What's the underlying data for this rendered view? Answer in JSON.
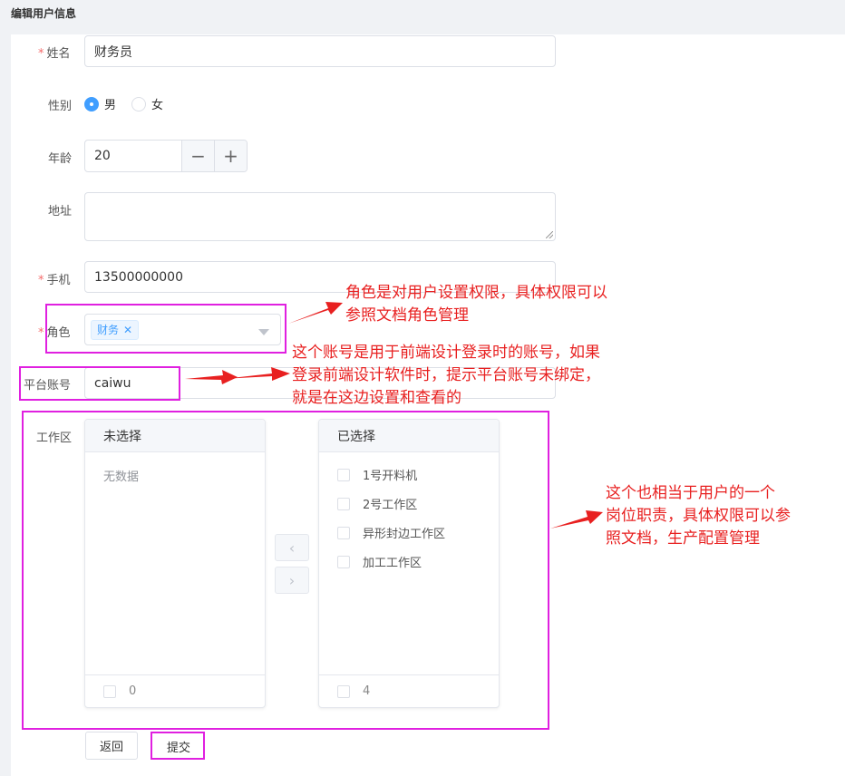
{
  "page": {
    "title": "编辑用户信息"
  },
  "form": {
    "name": {
      "label": "姓名",
      "required_mark": "*",
      "value": "财务员"
    },
    "gender": {
      "label": "性别",
      "options": [
        "男",
        "女"
      ],
      "selected": "男"
    },
    "age": {
      "label": "年龄",
      "value": "20",
      "minus": "−",
      "plus": "+"
    },
    "address": {
      "label": "地址",
      "value": ""
    },
    "phone": {
      "label": "手机",
      "required_mark": "*",
      "value": "13500000000"
    },
    "role": {
      "label": "角色",
      "required_mark": "*",
      "tag": "财务",
      "tag_close": "✕"
    },
    "platform_account": {
      "label": "平台账号",
      "value": "caiwu"
    },
    "workzone": {
      "label": "工作区",
      "left_title": "未选择",
      "left_empty": "无数据",
      "left_count": "0",
      "right_title": "已选择",
      "right_items": [
        "1号开料机",
        "2号工作区",
        "异形封边工作区",
        "加工工作区"
      ],
      "right_count": "4",
      "to_left": "‹",
      "to_right": "›"
    },
    "back_label": "返回",
    "submit_label": "提交"
  },
  "annotations": {
    "role_note": [
      "角色是对用户设置权限，具体权限可以",
      "参照文档角色管理"
    ],
    "account_note": [
      "这个账号是用于前端设计登录时的账号，如果",
      "登录前端设计软件时，提示平台账号未绑定，",
      "就是在这边设置和查看的"
    ],
    "workzone_note": [
      "这个也相当于用户的一个",
      "岗位职责，具体权限可以参",
      "照文档，生产配置管理"
    ]
  },
  "colors": {
    "highlight": "#e020e0",
    "annotation": "#e82020",
    "primary": "#409eff",
    "required": "#f56c6c"
  }
}
